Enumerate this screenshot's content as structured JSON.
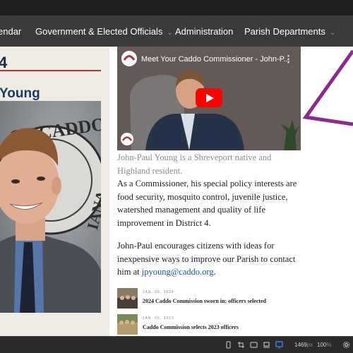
{
  "nav": {
    "items": [
      {
        "label": "endar"
      },
      {
        "label": "Government & Elected Officials",
        "caret": "⌄"
      },
      {
        "label": "Administration"
      },
      {
        "label": "Parish Departments",
        "caret": "⌄"
      }
    ]
  },
  "left": {
    "district_fragment": "4",
    "name_fragment": "Young",
    "seal_text": "OF CADDO",
    "seal_text_2": "IANA"
  },
  "video": {
    "title": "Meet Your Caddo Commissioner - John-P...",
    "menu": "⋮"
  },
  "article": {
    "caption": "John-Paul Young is a Shreveport native and Highland resident.",
    "para1": "As a Commissioner, his special policy interests are food security, mosquito control, juvenile justice, watershed management and quality of life improvement in District 4.",
    "para2_prefix": "John-Paul encourages citizens with ideas for inexpensive ways to improve our Parish to contact him at ",
    "email": "jpyoung@caddo.org",
    "para2_suffix": "."
  },
  "news": [
    {
      "date": "JAN. 08, 2024",
      "title": "2024 Caddo Commission sworn in; officers selected"
    },
    {
      "date": "JAN. 05, 2023",
      "title": "Caddo Commission selects 2023 officers"
    }
  ],
  "devtools": {
    "width_value": "1469",
    "width_unit": "px",
    "zoom": "100",
    "zoom_unit": "%"
  },
  "colors": {
    "accent_red": "#b5303d",
    "nav_bg": "#3a3a3a",
    "deco_purple": "#8a2a8e",
    "link_blue": "#1a4fbf"
  }
}
